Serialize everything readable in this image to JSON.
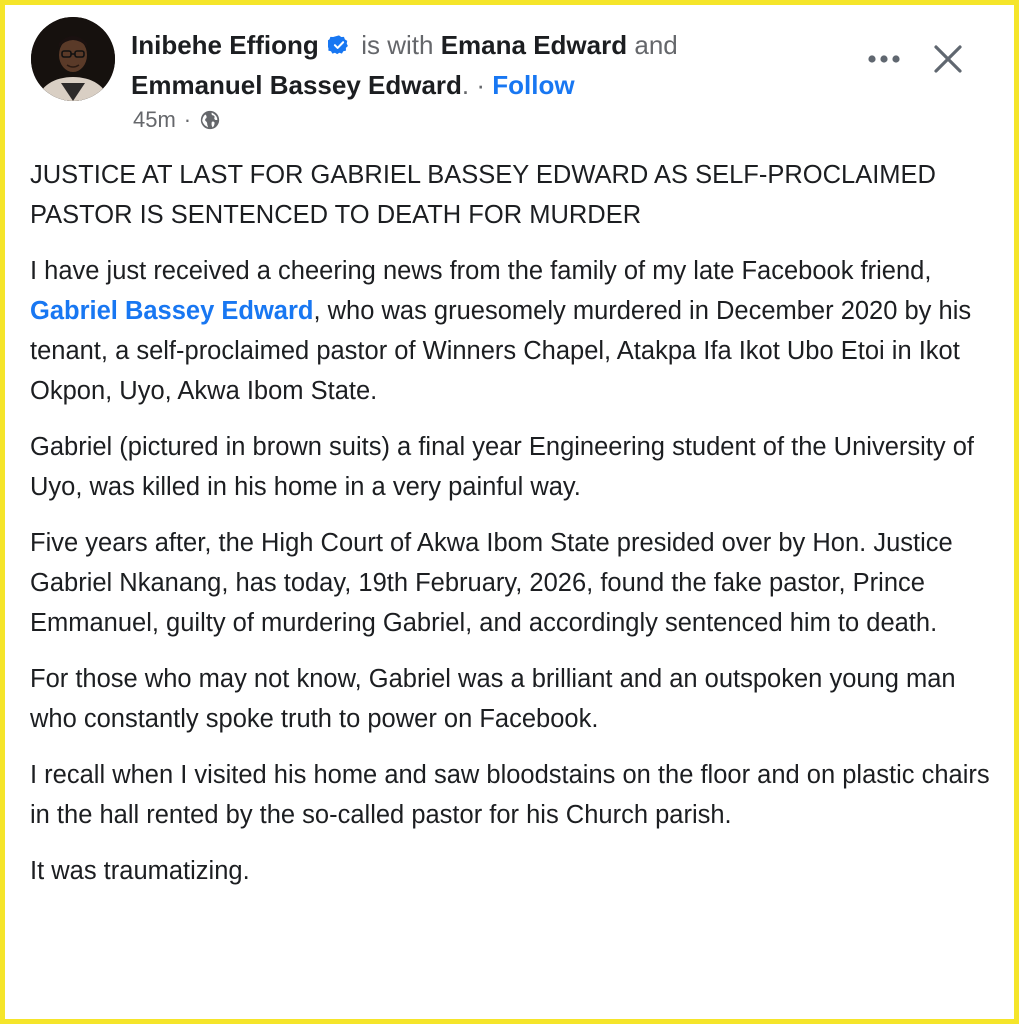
{
  "post": {
    "author": "Inibehe Effiong",
    "with_text": "is with",
    "tagged_1": "Emana Edward",
    "and_text": "and",
    "tagged_2": "Emmanuel Bassey Edward",
    "period": ".",
    "separator": "·",
    "follow_label": "Follow",
    "time": "45m",
    "meta_separator": "·"
  },
  "icons": {
    "verified": "verified-badge-icon",
    "audience": "globe-icon",
    "more": "more-options-icon",
    "close": "close-icon"
  },
  "colors": {
    "accent": "#1877f2",
    "muted": "#65676b",
    "text": "#1c1e21",
    "frame": "#f5e52a"
  },
  "content": {
    "headline": "JUSTICE AT LAST FOR GABRIEL BASSEY EDWARD AS SELF-PROCLAIMED PASTOR IS SENTENCED TO DEATH FOR MURDER",
    "p1_before": "I have just received a cheering news from the family of my late Facebook friend, ",
    "p1_link": "Gabriel Bassey Edward",
    "p1_after": ", who was gruesomely murdered in December 2020 by his tenant, a self-proclaimed pastor of Winners Chapel, Atakpa Ifa Ikot Ubo Etoi in Ikot Okpon, Uyo, Akwa Ibom State.",
    "p2": "Gabriel (pictured in brown suits) a final year Engineering student of the University of Uyo, was killed in his home in a very painful way.",
    "p3": "Five years after, the High Court of Akwa Ibom State presided over by Hon. Justice Gabriel Nkanang, has today, 19th February, 2026, found the fake pastor, Prince Emmanuel, guilty of murdering Gabriel, and accordingly sentenced him to death.",
    "p4": "For those who may not know, Gabriel was a brilliant and an outspoken young man who constantly spoke truth to power on Facebook.",
    "p5": "I recall when I visited his home and saw bloodstains on the floor and on plastic chairs in the hall rented by the so-called pastor for his Church parish.",
    "p6": "It was traumatizing."
  }
}
